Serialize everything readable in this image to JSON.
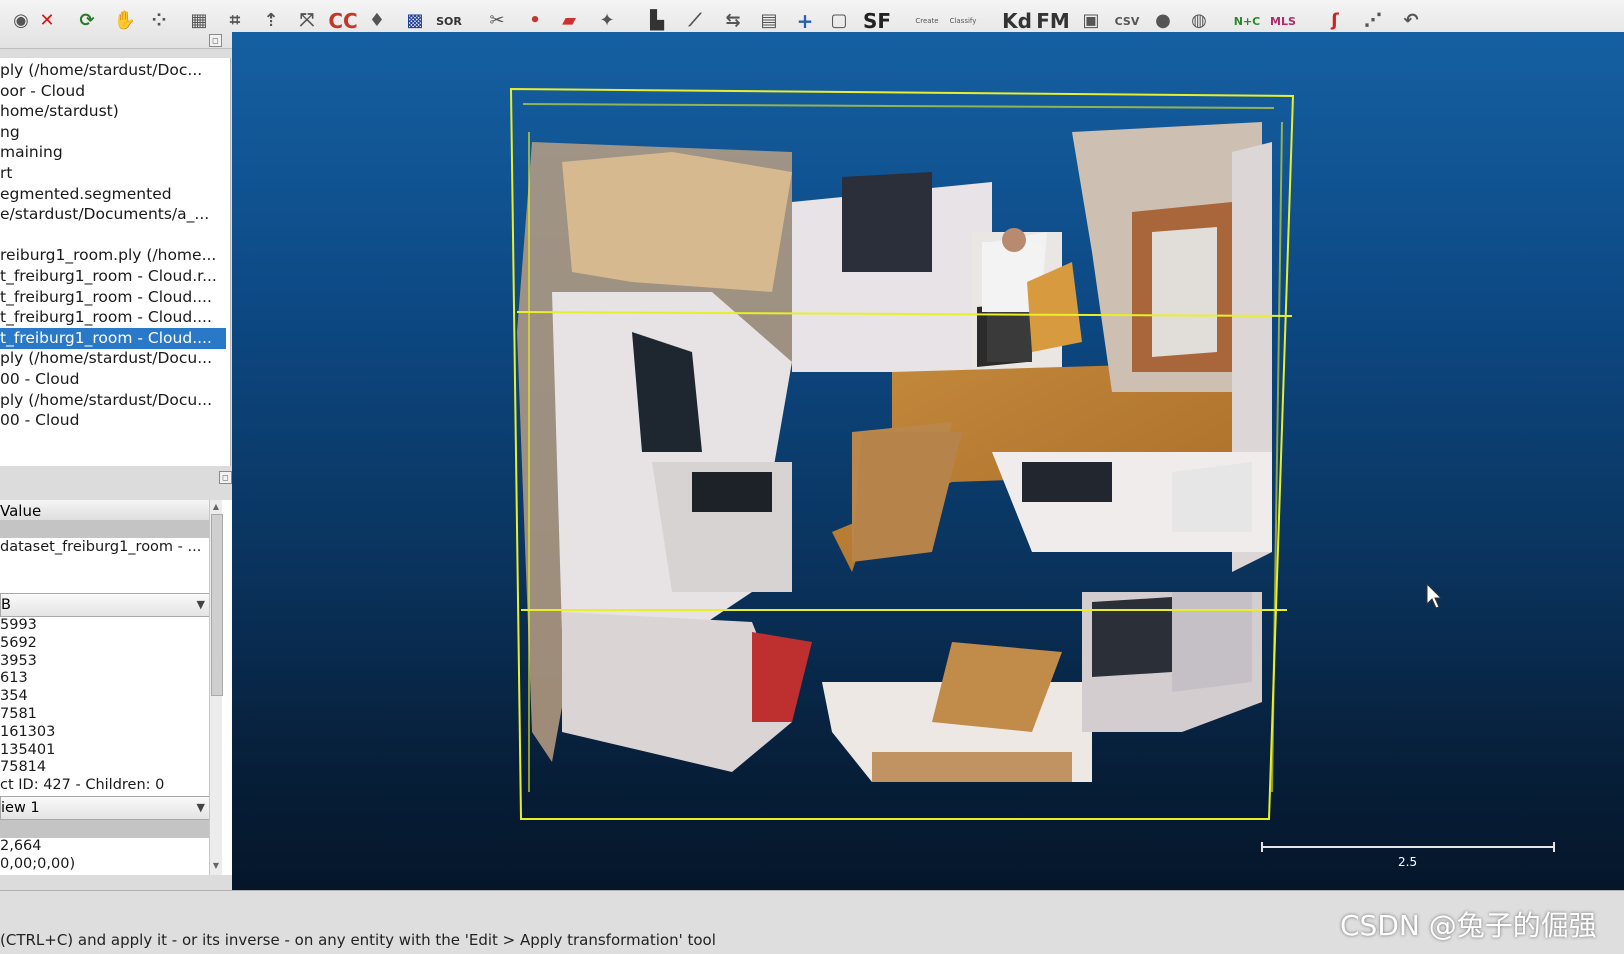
{
  "toolbar": {
    "buttons": [
      {
        "icon": "eye-icon",
        "label": ""
      },
      {
        "icon": "delete-x-icon",
        "label": ""
      },
      {
        "icon": "rotate-icon",
        "label": ""
      },
      {
        "icon": "hand-icon",
        "label": ""
      },
      {
        "icon": "sample-points-icon",
        "label": ""
      },
      {
        "icon": "grid-icon",
        "label": ""
      },
      {
        "icon": "crop-icon",
        "label": ""
      },
      {
        "icon": "normals-icon",
        "label": ""
      },
      {
        "icon": "registration-icon",
        "label": ""
      },
      {
        "icon": "cloud-compare-icon",
        "label": "CC"
      },
      {
        "icon": "pointer-icon",
        "label": ""
      },
      {
        "icon": "checkerboard-icon",
        "label": ""
      },
      {
        "icon": "sor-filter-icon",
        "label": "SOR"
      },
      {
        "icon": "scissors-icon",
        "label": ""
      },
      {
        "icon": "translate-icon",
        "label": ""
      },
      {
        "icon": "plane-icon",
        "label": ""
      },
      {
        "icon": "star-icon",
        "label": ""
      },
      {
        "icon": "histogram-icon",
        "label": ""
      },
      {
        "icon": "line-chart-icon",
        "label": ""
      },
      {
        "icon": "min-max-icon",
        "label": ""
      },
      {
        "icon": "list-icon",
        "label": ""
      },
      {
        "icon": "plus-icon",
        "label": "+"
      },
      {
        "icon": "clipboard-icon",
        "label": ""
      },
      {
        "icon": "scalar-field-icon",
        "label": "SF"
      },
      {
        "icon": "canupo-create-icon",
        "label": "Create"
      },
      {
        "icon": "canupo-classify-icon",
        "label": "Classify"
      },
      {
        "icon": "kd-tree-icon",
        "label": "Kd"
      },
      {
        "icon": "fast-marching-icon",
        "label": "FM"
      },
      {
        "icon": "export-icon",
        "label": ""
      },
      {
        "icon": "csv-icon",
        "label": "CSV"
      },
      {
        "icon": "sphere-icon",
        "label": ""
      },
      {
        "icon": "globe-icon",
        "label": ""
      },
      {
        "icon": "normals-curvature-icon",
        "label": "N+C"
      },
      {
        "icon": "mls-icon",
        "label": "MLS"
      },
      {
        "icon": "curve-icon",
        "label": ""
      },
      {
        "icon": "stat-icon",
        "label": ""
      },
      {
        "icon": "back-icon",
        "label": ""
      }
    ]
  },
  "db_tree": {
    "rows": [
      "ply (/home/stardust/Doc...",
      "oor - Cloud",
      "home/stardust)",
      "ng",
      "maining",
      "rt",
      "egmented.segmented",
      "e/stardust/Documents/a_...",
      "",
      "reiburg1_room.ply (/home...",
      "t_freiburg1_room - Cloud.r...",
      "t_freiburg1_room - Cloud....",
      "t_freiburg1_room - Cloud....",
      "t_freiburg1_room - Cloud....",
      "ply (/home/stardust/Docu...",
      "00 - Cloud",
      "ply (/home/stardust/Docu...",
      "00 - Cloud"
    ],
    "selected_index": 13
  },
  "properties": {
    "header_value": "Value",
    "name_value": "dataset_freiburg1_room - ...",
    "color_combo": "B",
    "numbers": [
      "5993",
      "5692",
      "3953",
      "613",
      "354",
      "7581",
      "161303",
      "135401",
      "75814"
    ],
    "object_info": "ct ID: 427 - Children: 0",
    "view_combo": "iew 1",
    "bottom_values": [
      "2,664",
      "0,00;0,00)"
    ]
  },
  "viewer": {
    "scale_label": "2.5",
    "bbox_color": "#e8ef2a",
    "background_top": "#1560a2",
    "background_bottom": "#05162a"
  },
  "status": {
    "text": "(CTRL+C) and apply it - or its inverse - on any entity with the 'Edit > Apply transformation' tool"
  },
  "watermark": "CSDN @兔子的倔强"
}
